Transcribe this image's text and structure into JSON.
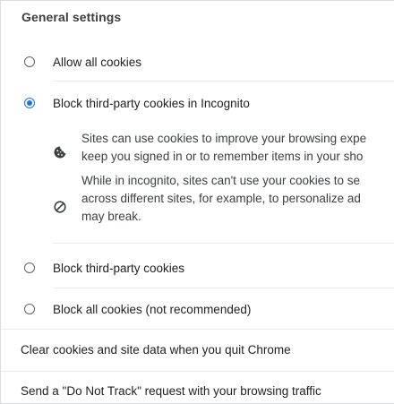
{
  "section": {
    "title": "General settings"
  },
  "options": [
    {
      "label": "Allow all cookies",
      "selected": false
    },
    {
      "label": "Block third-party cookies in Incognito",
      "selected": true
    },
    {
      "label": "Block third-party cookies",
      "selected": false
    },
    {
      "label": "Block all cookies (not recommended)",
      "selected": false
    }
  ],
  "incognito_info": {
    "cookie_icon": "cookie-icon",
    "cookie_lines": [
      "Sites can use cookies to improve your browsing expe",
      "keep you signed in or to remember items in your sho"
    ],
    "block_icon": "block-icon",
    "block_lines": [
      "While in incognito, sites can't use your cookies to se",
      "across different sites, for example, to personalize ad",
      "may break."
    ]
  },
  "rows": {
    "clear_on_quit": "Clear cookies and site data when you quit Chrome",
    "do_not_track": "Send a \"Do Not Track\" request with your browsing traffic"
  },
  "colors": {
    "accent": "#1a73e8",
    "text": "#202124",
    "secondary_text": "#3c4043",
    "divider": "#e8eaed"
  }
}
